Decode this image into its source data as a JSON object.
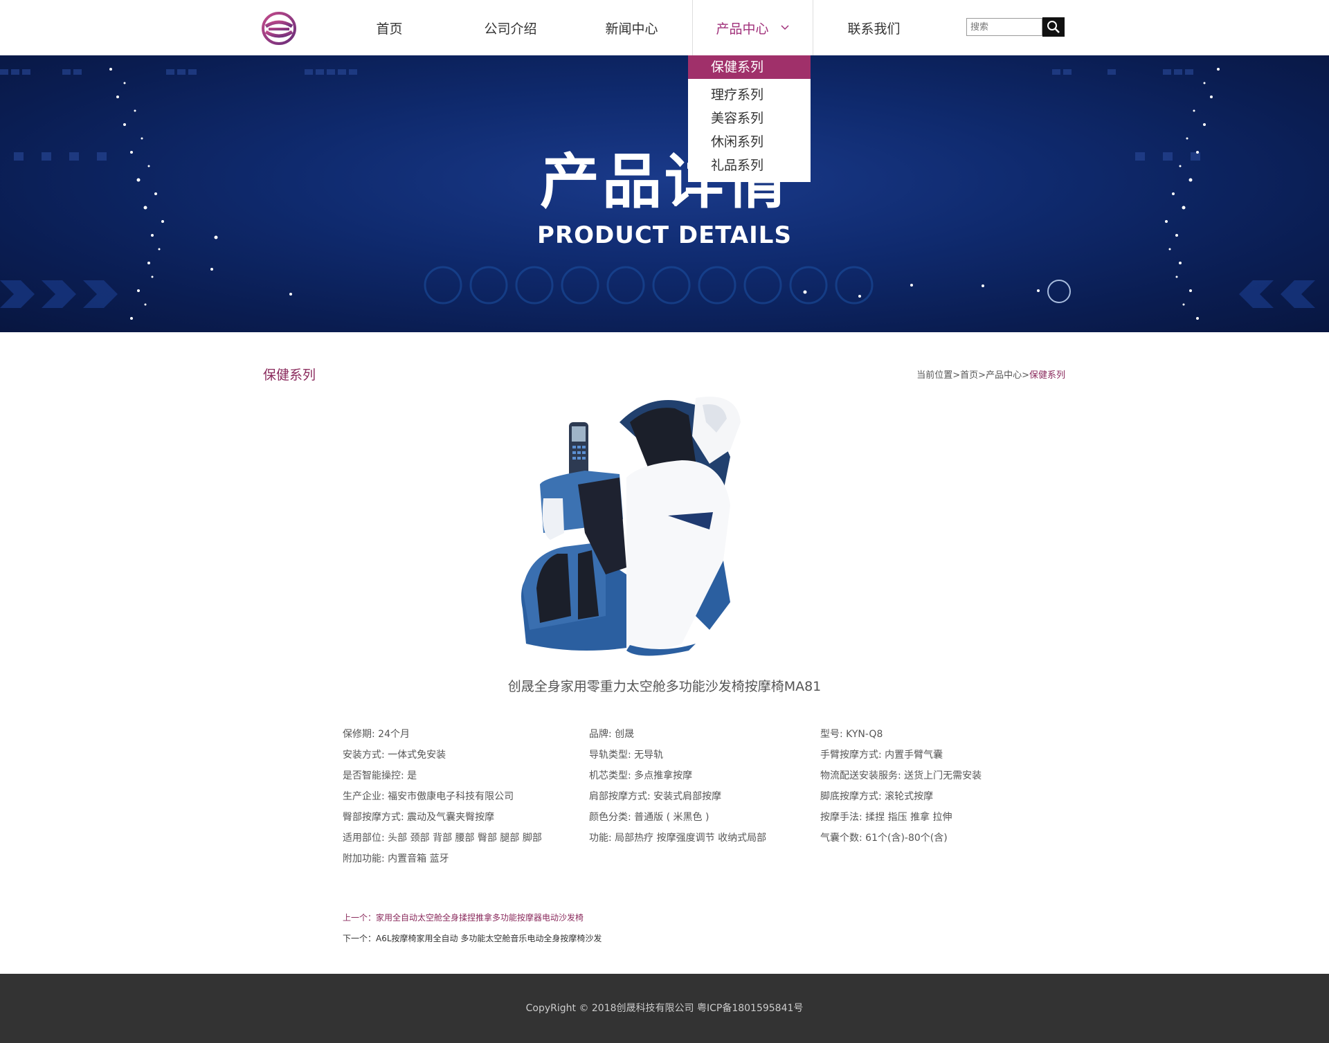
{
  "nav": {
    "items": [
      "首页",
      "公司介绍",
      "新闻中心",
      "产品中心",
      "联系我们"
    ],
    "search_placeholder": "搜索"
  },
  "dropdown": [
    "保健系列",
    "理疗系列",
    "美容系列",
    "休闲系列",
    "礼品系列"
  ],
  "banner": {
    "title": "产品详情",
    "subtitle": "PRODUCT DETAILS"
  },
  "section": {
    "title": "保健系列",
    "breadcrumb": {
      "label": "当前位置",
      "sep": ">",
      "home": "首页",
      "products": "产品中心",
      "current": "保健系列"
    }
  },
  "product": {
    "name": "创晟全身家用零重力太空舱多功能沙发椅按摩椅MA81",
    "specs": [
      [
        "保修期: 24个月",
        "品牌: 创晟",
        "型号: KYN-Q8"
      ],
      [
        "安装方式: 一体式免安装",
        "导轨类型: 无导轨",
        "手臂按摩方式: 内置手臂气囊"
      ],
      [
        "是否智能操控: 是",
        "机芯类型: 多点推拿按摩",
        "物流配送安装服务: 送货上门无需安装"
      ],
      [
        "生产企业: 福安市傲康电子科技有限公司",
        "肩部按摩方式: 安装式肩部按摩",
        "脚底按摩方式: 滚轮式按摩"
      ],
      [
        "臀部按摩方式: 震动及气囊夹臀按摩",
        "颜色分类: 普通版 ( 米黑色 )",
        "按摩手法: 揉捏 指压 推拿 拉伸"
      ],
      [
        "适用部位: 头部 颈部 背部 腰部 臀部 腿部 脚部",
        "功能: 局部热疗 按摩强度调节 收纳式局部",
        "气囊个数: 61个(含)-80个(含)"
      ],
      [
        "附加功能: 内置音箱 蓝牙",
        "",
        ""
      ]
    ]
  },
  "prev_next": {
    "prev": "上一个：家用全自动太空舱全身揉捏推拿多功能按摩器电动沙发椅",
    "next": "下一个：A6L按摩椅家用全自动 多功能太空舱音乐电动全身按摩椅沙发"
  },
  "footer": {
    "copyright": "CopyRight © 2018创晟科技有限公司 粤ICP备1801595841号"
  },
  "colors": {
    "accent": "#a0306a",
    "banner": "#0f2a6e",
    "footer": "#333333"
  }
}
